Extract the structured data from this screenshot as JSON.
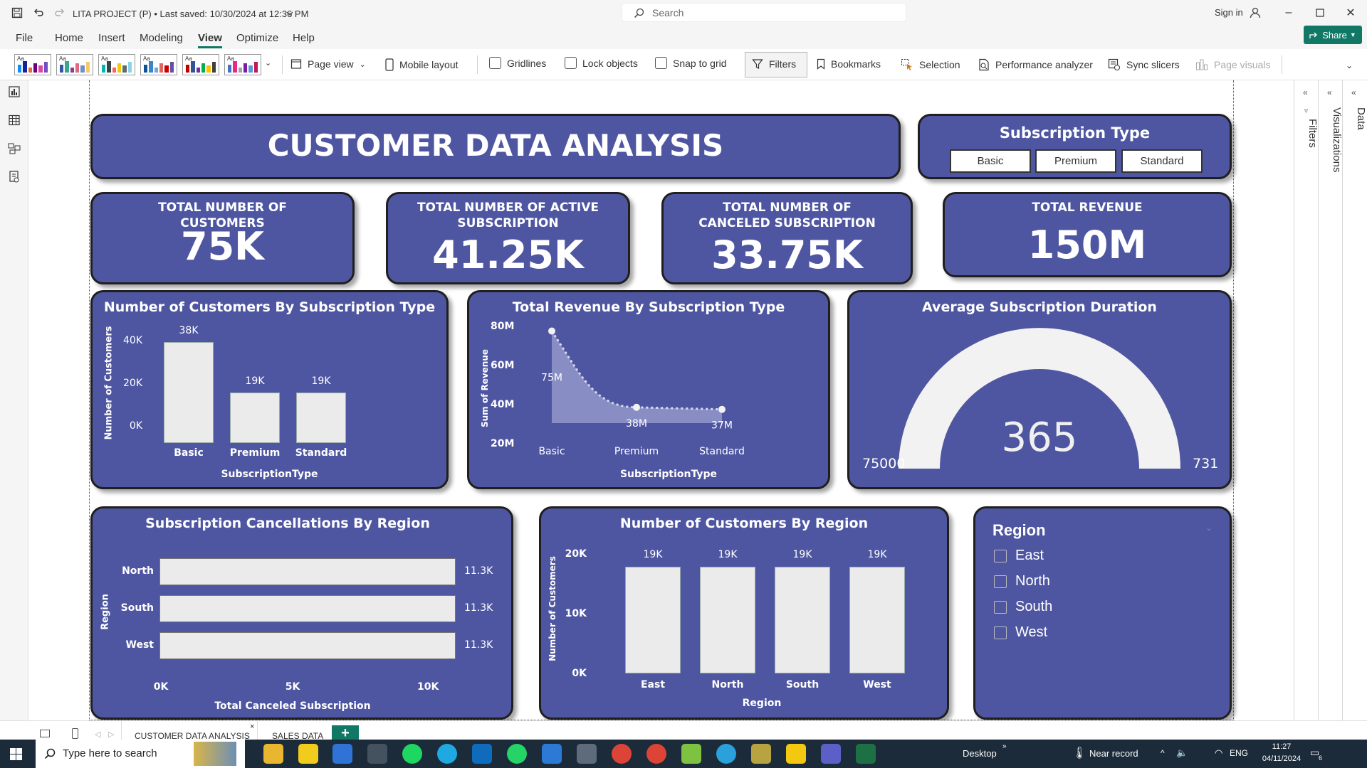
{
  "window": {
    "doc_title": "LITA PROJECT (P) • Last saved: 10/30/2024 at 12:36 PM",
    "search_placeholder": "Search",
    "sign_in": "Sign in"
  },
  "menu": [
    "File",
    "Home",
    "Insert",
    "Modeling",
    "View",
    "Optimize",
    "Help"
  ],
  "share_label": "Share",
  "ribbon": {
    "page_view": "Page view",
    "mobile_layout": "Mobile layout",
    "gridlines": "Gridlines",
    "lock_objects": "Lock objects",
    "snap_to_grid": "Snap to grid",
    "filters": "Filters",
    "bookmarks": "Bookmarks",
    "selection": "Selection",
    "performance_analyzer": "Performance analyzer",
    "sync_slicers": "Sync slicers",
    "page_visuals": "Page visuals",
    "theme_label": "Aa"
  },
  "dashboard": {
    "title": "CUSTOMER DATA ANALYSIS",
    "subscription_slicer": {
      "title": "Subscription Type",
      "options": [
        "Basic",
        "Premium",
        "Standard"
      ]
    },
    "kpis": [
      {
        "label": "TOTAL NUMBER OF CUSTOMERS",
        "value": "75K"
      },
      {
        "label": "TOTAL NUMBER OF ACTIVE SUBSCRIPTION",
        "value": "41.25K"
      },
      {
        "label": "TOTAL NUMBER OF CANCELED SUBSCRIPTION",
        "value": "33.75K"
      },
      {
        "label": "TOTAL REVENUE",
        "value": "150M"
      }
    ],
    "gauge": {
      "title": "Average Subscription Duration",
      "value": "365",
      "min": "75000",
      "max": "731",
      "fraction": 0.37
    },
    "region_slicer": {
      "title": "Region",
      "items": [
        "East",
        "North",
        "South",
        "West"
      ]
    }
  },
  "chart_data": [
    {
      "type": "bar",
      "title": "Number of Customers By Subscription Type",
      "xlabel": "SubscriptionType",
      "ylabel": "Number of Customers",
      "categories": [
        "Basic",
        "Premium",
        "Standard"
      ],
      "values": [
        38000,
        19000,
        19000
      ],
      "data_labels": [
        "38K",
        "19K",
        "19K"
      ],
      "yticks": [
        "0K",
        "20K",
        "40K"
      ],
      "ylim": [
        0,
        40000
      ]
    },
    {
      "type": "area",
      "title": "Total Revenue By Subscription Type",
      "xlabel": "SubscriptionType",
      "ylabel": "Sum of Revenue",
      "categories": [
        "Basic",
        "Premium",
        "Standard"
      ],
      "values": [
        75000000,
        38000000,
        37000000
      ],
      "data_labels": [
        "75M",
        "38M",
        "37M"
      ],
      "yticks": [
        "20M",
        "40M",
        "60M",
        "80M"
      ],
      "ylim": [
        20000000,
        80000000
      ]
    },
    {
      "type": "bar",
      "orientation": "horizontal",
      "title": "Subscription Cancellations By Region",
      "xlabel": "Total Canceled Subscription",
      "ylabel": "Region",
      "categories": [
        "North",
        "South",
        "West"
      ],
      "values": [
        11300,
        11300,
        11300
      ],
      "data_labels": [
        "11.3K",
        "11.3K",
        "11.3K"
      ],
      "xticks": [
        "0K",
        "5K",
        "10K"
      ],
      "xlim": [
        0,
        10000
      ]
    },
    {
      "type": "bar",
      "title": "Number of Customers By Region",
      "xlabel": "Region",
      "ylabel": "Number of Customers",
      "categories": [
        "East",
        "North",
        "South",
        "West"
      ],
      "values": [
        19000,
        19000,
        19000,
        19000
      ],
      "data_labels": [
        "19K",
        "19K",
        "19K",
        "19K"
      ],
      "yticks": [
        "0K",
        "10K",
        "20K"
      ],
      "ylim": [
        0,
        20000
      ]
    }
  ],
  "panes": {
    "filters": "Filters",
    "visualizations": "Visualizations",
    "data": "Data"
  },
  "page_tabs": [
    "CUSTOMER DATA ANALYSIS",
    "SALES DATA"
  ],
  "taskbar": {
    "search_placeholder": "Type here to search",
    "desktop": "Desktop",
    "weather": "Near record",
    "lang": "ENG",
    "time": "11:27",
    "date": "04/11/2024",
    "notif_count": "6"
  }
}
